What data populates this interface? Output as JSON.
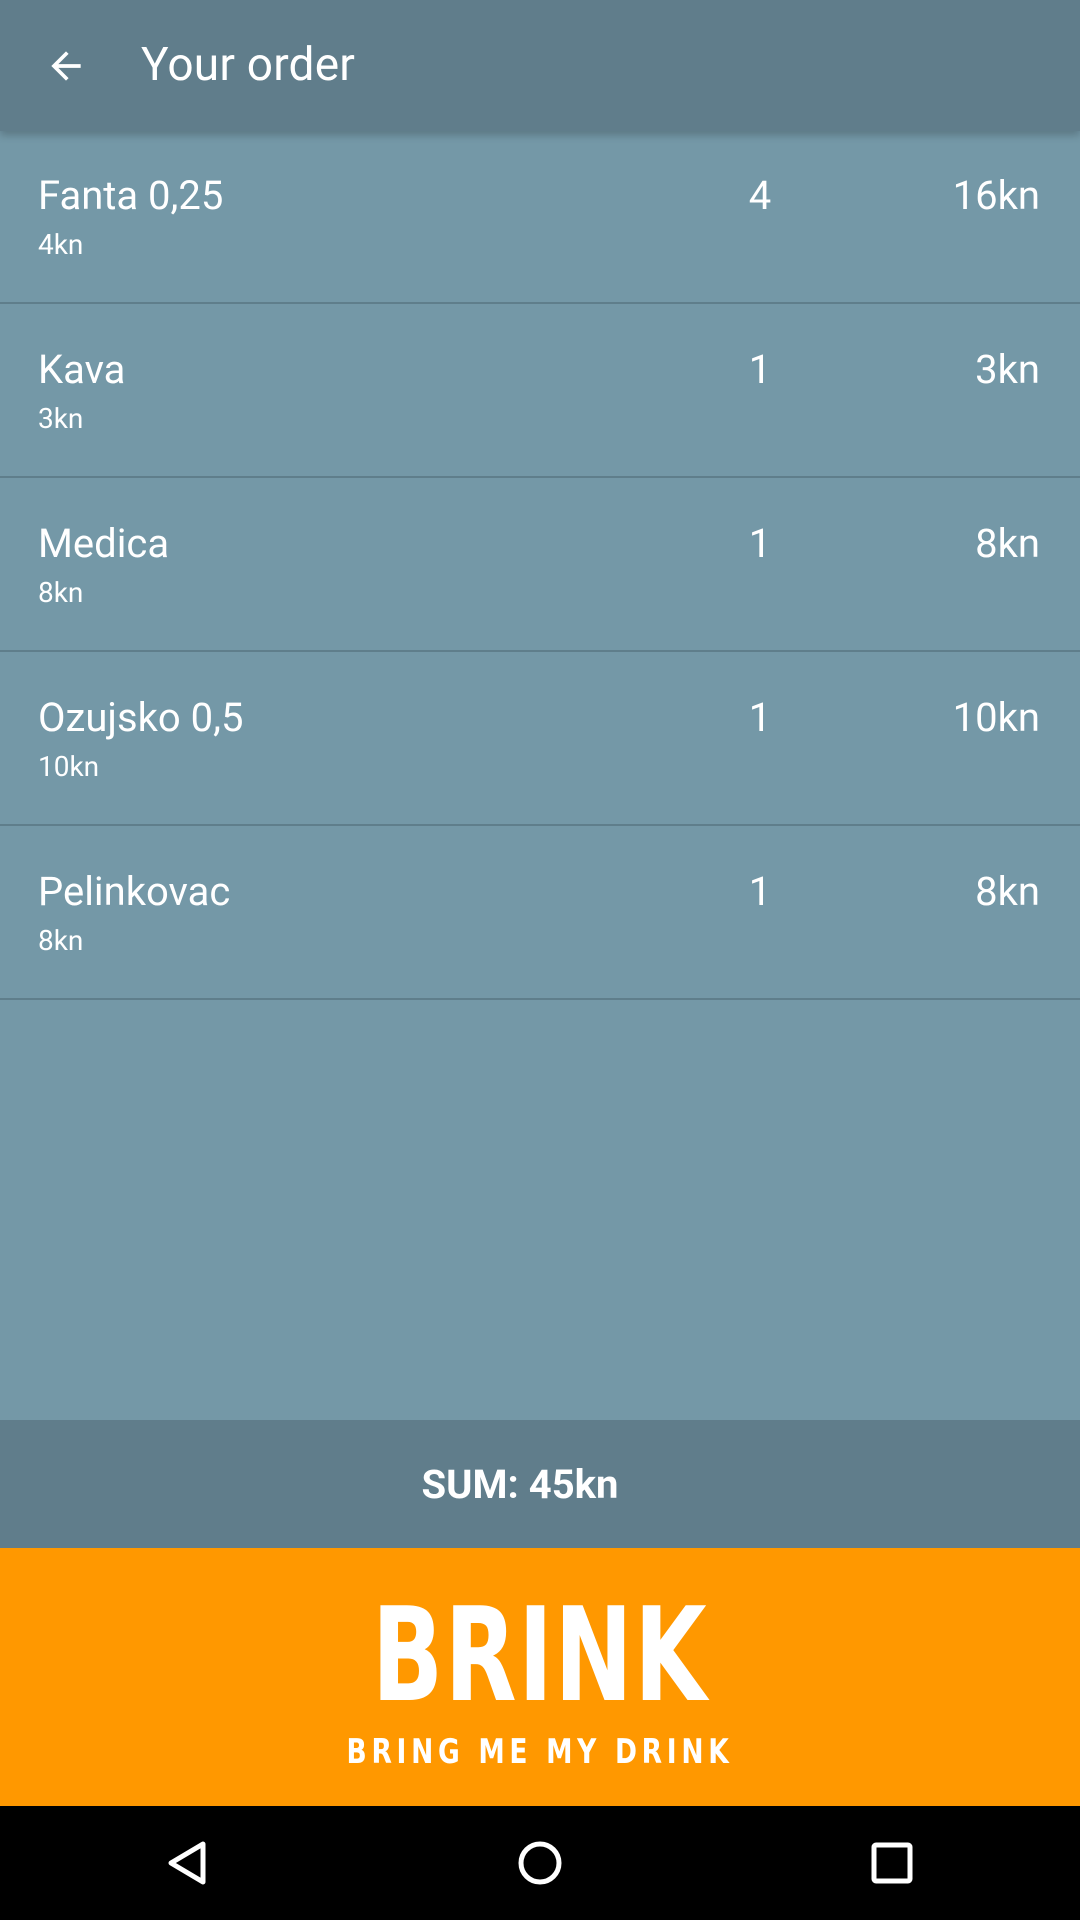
{
  "appbar": {
    "title": "Your order",
    "back_icon": "arrow-back-icon"
  },
  "order": {
    "items": [
      {
        "name": "Fanta 0,25",
        "unit_price": "4kn",
        "quantity": "4",
        "total": "16kn"
      },
      {
        "name": "Kava",
        "unit_price": "3kn",
        "quantity": "1",
        "total": "3kn"
      },
      {
        "name": "Medica",
        "unit_price": "8kn",
        "quantity": "1",
        "total": "8kn"
      },
      {
        "name": "Ozujsko 0,5",
        "unit_price": "10kn",
        "quantity": "1",
        "total": "10kn"
      },
      {
        "name": "Pelinkovac",
        "unit_price": "8kn",
        "quantity": "1",
        "total": "8kn"
      }
    ]
  },
  "summary": {
    "sum_label": "SUM: 45kn"
  },
  "brand": {
    "logo": "BRINK",
    "tagline": "BRING ME MY DRINK"
  },
  "navigation": {
    "back_icon": "nav-back-icon",
    "home_icon": "nav-home-icon",
    "recents_icon": "nav-recents-icon"
  },
  "colors": {
    "appbar": "#607d8b",
    "background": "#7498a7",
    "divider": "#5f7e8b",
    "brand": "#ff9800",
    "navbar": "#000000",
    "text": "#ffffff"
  }
}
